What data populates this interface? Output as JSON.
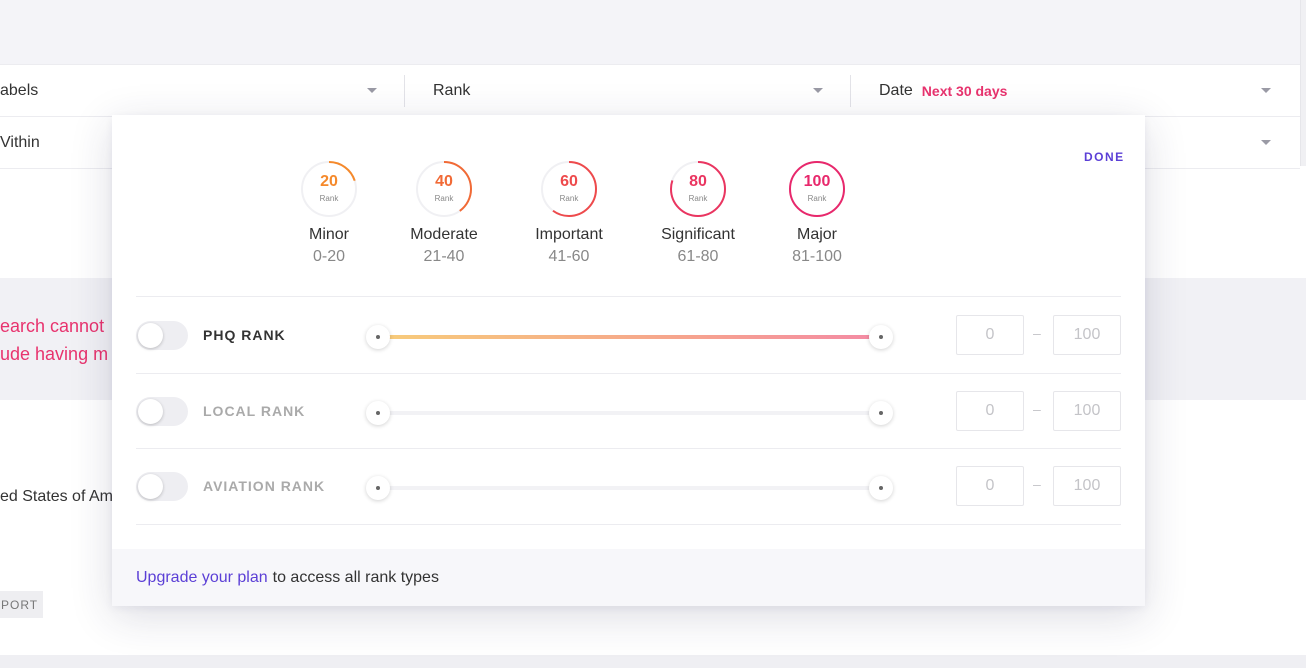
{
  "filters": {
    "labels_text": "abels",
    "rank_text": "Rank",
    "date_label": "Date",
    "date_range": "Next 30 days",
    "within_text": "Vithin"
  },
  "background": {
    "warning_line1": "earch cannot",
    "warning_line2": "ude having m",
    "country": "ed States of Am",
    "export_label": "PORT"
  },
  "modal": {
    "done_label": "DONE",
    "rank_levels": [
      {
        "value": "20",
        "unit": "Rank",
        "name": "Minor",
        "range": "0-20",
        "color": "#f5892b",
        "fill": 0.2
      },
      {
        "value": "40",
        "unit": "Rank",
        "name": "Moderate",
        "range": "21-40",
        "color": "#f16a36",
        "fill": 0.4
      },
      {
        "value": "60",
        "unit": "Rank",
        "name": "Important",
        "range": "41-60",
        "color": "#ee4a4c",
        "fill": 0.6
      },
      {
        "value": "80",
        "unit": "Rank",
        "name": "Significant",
        "range": "61-80",
        "color": "#ea3560",
        "fill": 0.8
      },
      {
        "value": "100",
        "unit": "Rank",
        "name": "Major",
        "range": "81-100",
        "color": "#e8286c",
        "fill": 1.0
      }
    ],
    "rank_rows": [
      {
        "label": "PHQ RANK",
        "enabled": true,
        "min": "0",
        "max": "100"
      },
      {
        "label": "LOCAL RANK",
        "enabled": false,
        "min": "0",
        "max": "100"
      },
      {
        "label": "AVIATION RANK",
        "enabled": false,
        "min": "0",
        "max": "100"
      }
    ],
    "range_dash": "–",
    "footer": {
      "link_text": "Upgrade your plan",
      "text": "to access all rank types"
    }
  },
  "colors": {
    "accent": "#5b3fd6",
    "pink": "#e8336e"
  }
}
